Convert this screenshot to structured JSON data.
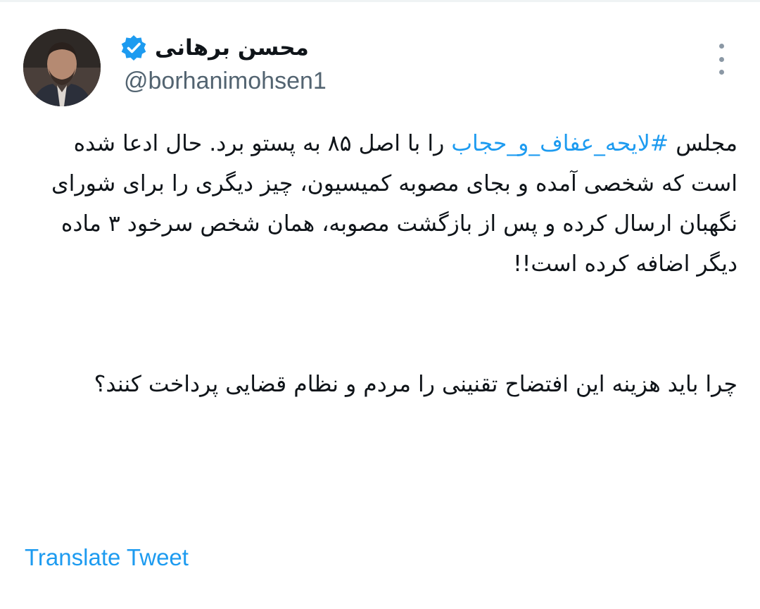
{
  "tweet": {
    "author": {
      "display_name": "محسن برهانی",
      "handle": "@borhanimohsen1",
      "verified": true,
      "verified_icon": "verified-badge-icon",
      "avatar_icon": "profile-photo"
    },
    "more_icon": "more-vertical-icon",
    "body": {
      "p1_lead": "مجلس ",
      "p1_hashtag": "#لایحه_عفاف_و_حجاب",
      "p1_rest": " را با اصل ۸۵ به پستو برد. حال ادعا شده است که شخصی آمده و بجای مصوبه کمیسیون، چیز دیگری را برای شورای نگهبان ارسال کرده و پس از بازگشت مصوبه، همان شخص سرخود ۳ ماده دیگر اضافه کرده است!!",
      "p2": "چرا باید هزینه این افتضاح تقنینی را مردم و نظام قضایی پرداخت کنند؟"
    },
    "translate_label": "Translate Tweet"
  },
  "colors": {
    "link": "#1d9bf0",
    "text": "#0f1419",
    "secondary": "#536471"
  }
}
